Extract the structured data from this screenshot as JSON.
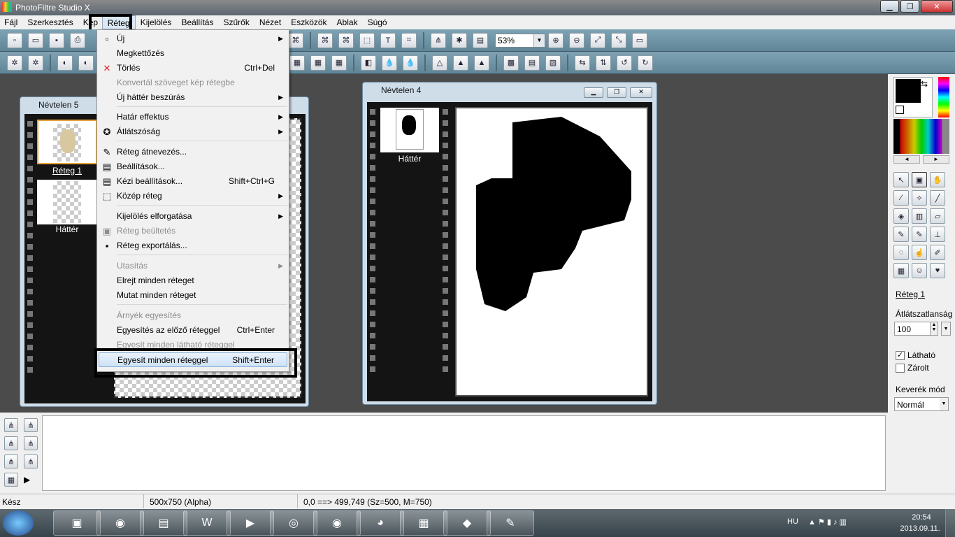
{
  "app": {
    "title": "PhotoFiltre Studio X"
  },
  "menubar": [
    "Fájl",
    "Szerkesztés",
    "Kép",
    "Réteg",
    "Kijelölés",
    "Beállítás",
    "Szűrők",
    "Nézet",
    "Eszközök",
    "Ablak",
    "Súgó"
  ],
  "toolbar": {
    "zoom": "53%"
  },
  "menu_items": [
    {
      "label": "Új",
      "shortcut": "",
      "arrow": true,
      "disabled": false,
      "icon": "new-doc-icon"
    },
    {
      "label": "Megkettőzés",
      "shortcut": "",
      "arrow": false,
      "disabled": false,
      "icon": ""
    },
    {
      "label": "Törlés",
      "shortcut": "Ctrl+Del",
      "arrow": false,
      "disabled": false,
      "icon": "delete-x-icon"
    },
    {
      "label": "Konvertál szöveget kép rétegbe",
      "shortcut": "",
      "arrow": false,
      "disabled": true,
      "icon": ""
    },
    {
      "label": "Új háttér beszúrás",
      "shortcut": "",
      "arrow": true,
      "disabled": false,
      "icon": ""
    },
    {
      "label": "Határ effektus",
      "shortcut": "",
      "arrow": true,
      "disabled": false,
      "icon": ""
    },
    {
      "label": "Átlátszóság",
      "shortcut": "",
      "arrow": true,
      "disabled": false,
      "icon": "transparency-icon"
    },
    {
      "label": "Réteg átnevezés...",
      "shortcut": "",
      "arrow": false,
      "disabled": false,
      "icon": "rename-pencil-icon"
    },
    {
      "label": "Beállítások...",
      "shortcut": "",
      "arrow": false,
      "disabled": false,
      "icon": "settings-window-icon"
    },
    {
      "label": "Kézi beállítások...",
      "shortcut": "Shift+Ctrl+G",
      "arrow": false,
      "disabled": false,
      "icon": "manual-settings-icon"
    },
    {
      "label": "Közép réteg",
      "shortcut": "",
      "arrow": true,
      "disabled": false,
      "icon": "center-layer-icon"
    },
    {
      "label": "Kijelölés elforgatása",
      "shortcut": "",
      "arrow": true,
      "disabled": false,
      "icon": ""
    },
    {
      "label": "Réteg beültetés",
      "shortcut": "",
      "arrow": false,
      "disabled": true,
      "icon": "embed-layer-icon"
    },
    {
      "label": "Réteg exportálás...",
      "shortcut": "",
      "arrow": false,
      "disabled": false,
      "icon": "export-floppy-icon"
    },
    {
      "label": "Utasítás",
      "shortcut": "",
      "arrow": true,
      "disabled": true,
      "icon": ""
    },
    {
      "label": "Elrejt minden réteget",
      "shortcut": "",
      "arrow": false,
      "disabled": false,
      "icon": ""
    },
    {
      "label": "Mutat minden réteget",
      "shortcut": "",
      "arrow": false,
      "disabled": false,
      "icon": ""
    },
    {
      "label": "Árnyék egyesítés",
      "shortcut": "",
      "arrow": false,
      "disabled": true,
      "icon": ""
    },
    {
      "label": "Egyesítés az előző réteggel",
      "shortcut": "Ctrl+Enter",
      "arrow": false,
      "disabled": false,
      "icon": ""
    },
    {
      "label": "Egyesít minden látható réteggel",
      "shortcut": "",
      "arrow": false,
      "disabled": true,
      "icon": ""
    },
    {
      "label": "Egyesít minden réteggel",
      "shortcut": "Shift+Enter",
      "arrow": false,
      "disabled": false,
      "icon": ""
    }
  ],
  "doc5": {
    "title": "Névtelen 5",
    "layers": [
      "Réteg 1",
      "Háttér"
    ]
  },
  "doc4": {
    "title": "Névtelen 4",
    "layers": [
      "Háttér"
    ]
  },
  "rpanel": {
    "layer_name": "Réteg 1",
    "opacity_label": "Átlátszatlanság",
    "opacity_value": "100",
    "visible_label": "Látható",
    "locked_label": "Zárolt",
    "blend_label": "Keverék mód",
    "blend_value": "Normál"
  },
  "status": {
    "ready": "Kész",
    "size": "500x750 (Alpha)",
    "coords": "0,0 ==> 499,749 (Sz=500, M=750)"
  },
  "tray": {
    "lang": "HU",
    "time": "20:54",
    "date": "2013.09.11."
  }
}
